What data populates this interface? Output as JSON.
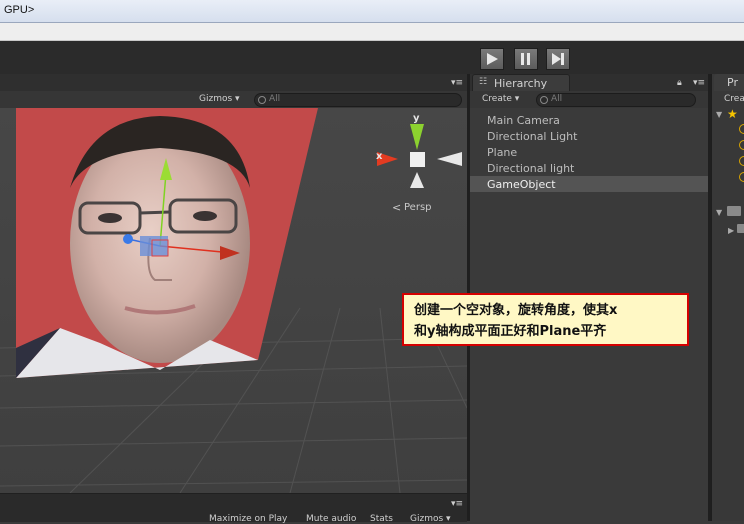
{
  "window": {
    "title": "GPU>"
  },
  "scene": {
    "gizmos_label": "Gizmos ▾",
    "search_placeholder": "All",
    "persp_label": "Persp",
    "axis_y": "y",
    "axis_x": "x",
    "bottom_labels": [
      "Maximize on Play",
      "Mute audio",
      "Stats",
      "Gizmos ▾"
    ]
  },
  "hierarchy": {
    "tab_label": "Hierarchy",
    "create_label": "Create ▾",
    "search_placeholder": "All",
    "items": [
      "Main Camera",
      "Directional Light",
      "Plane",
      "Directional light",
      "GameObject"
    ],
    "selected_index": 4
  },
  "project": {
    "tab_label": "Pr",
    "create_label": "Crea"
  },
  "callout": {
    "line1": "创建一个空对象，旋转角度，使其x",
    "line2": "和y轴构成平面正好和Plane平齐",
    "border_color": "#d40000",
    "background_color": "#fff8c5"
  }
}
